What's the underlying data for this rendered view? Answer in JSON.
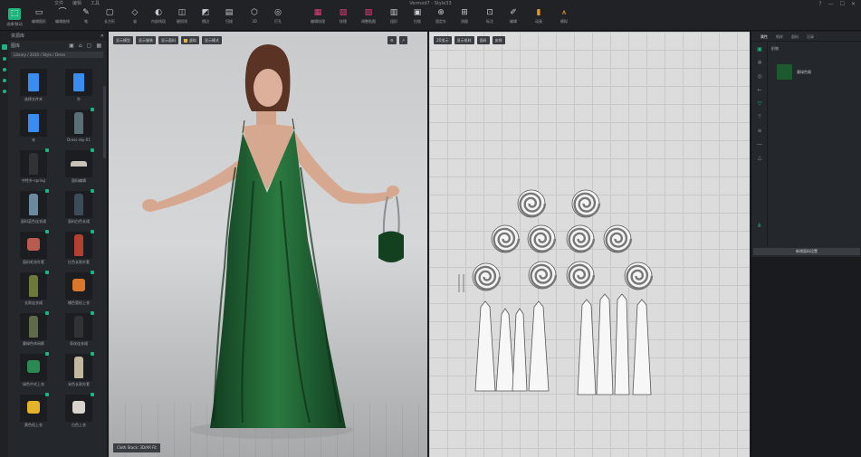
{
  "window": {
    "title": "Vermod7 - Style33",
    "menus": [
      "文件",
      "编辑",
      "工具"
    ],
    "controls": [
      "?",
      "—",
      "☐",
      "✕"
    ]
  },
  "toolbar": {
    "tools": [
      {
        "label": "选择/移动",
        "icon": "cursor-icon",
        "style": "accent"
      },
      {
        "label": "编辑图形",
        "icon": "edit-icon"
      },
      {
        "label": "编辑曲线",
        "icon": "curve-icon"
      },
      {
        "label": "笔",
        "icon": "pen-icon"
      },
      {
        "label": "长方形",
        "icon": "rectangle-icon"
      },
      {
        "label": "省",
        "icon": "dart-icon"
      },
      {
        "label": "内部线段",
        "icon": "internal-line-icon"
      },
      {
        "label": "缝纫线",
        "icon": "sewing-icon"
      },
      {
        "label": "褶边",
        "icon": "pleat-icon"
      },
      {
        "label": "归拔",
        "icon": "shrink-icon"
      },
      {
        "label": "3D",
        "icon": "cube-icon"
      },
      {
        "label": "打孔",
        "icon": "punch-icon"
      },
      {
        "label": "编辑纹理",
        "icon": "texture-edit-icon",
        "style": "pink"
      },
      {
        "label": "纹理",
        "icon": "texture-icon",
        "style": "pink"
      },
      {
        "label": "调整贴图",
        "icon": "adjust-map-icon",
        "style": "pink"
      },
      {
        "label": "纽扣",
        "icon": "button-icon"
      },
      {
        "label": "拉链",
        "icon": "zipper-icon"
      },
      {
        "label": "固定针",
        "icon": "pin-icon"
      },
      {
        "label": "测量",
        "icon": "measure-icon"
      },
      {
        "label": "标注",
        "icon": "annotate-icon"
      },
      {
        "label": "编辑",
        "icon": "edit-note-icon"
      },
      {
        "label": "动画",
        "icon": "chart-icon",
        "style": "orange"
      },
      {
        "label": "模拟",
        "icon": "hanger-icon",
        "style": "orange"
      }
    ]
  },
  "library": {
    "panel_title": "资源库",
    "tab_label": "图库",
    "path": "Library / 2020 / Style / Dress",
    "items": [
      {
        "label": "选择文件夹",
        "shape": "folder",
        "color": "#3a8df0"
      },
      {
        "label": "外",
        "shape": "folder",
        "color": "#3a8df0"
      },
      {
        "label": "夹",
        "shape": "folder",
        "color": "#3a8df0"
      },
      {
        "label": "Dress-sky-01",
        "shape": "dress",
        "color": "#5b6f76"
      },
      {
        "label": "中性外-spring",
        "shape": "dress",
        "color": "#2f3336"
      },
      {
        "label": "面料编辑",
        "shape": "hat",
        "color": "#c7c2b8"
      },
      {
        "label": "面料蓝色连衣裙",
        "shape": "dress",
        "color": "#6a8aa0"
      },
      {
        "label": "面料白色长裙",
        "shape": "dress",
        "color": "#3c4c58"
      },
      {
        "label": "面料毛衣外套",
        "shape": "top",
        "color": "#b85c50"
      },
      {
        "label": "红色长款外套",
        "shape": "dress",
        "color": "#b3412f"
      },
      {
        "label": "长款连衣裙",
        "shape": "dress",
        "color": "#6b7a3a"
      },
      {
        "label": "橘色宽松上衣",
        "shape": "top",
        "color": "#d9782c"
      },
      {
        "label": "墨绿色休闲裤",
        "shape": "dress",
        "color": "#5f6a4a"
      },
      {
        "label": "条纹连衣裙",
        "shape": "dress",
        "color": "#2f3336"
      },
      {
        "label": "绿色中式上衣",
        "shape": "top",
        "color": "#2b8a52"
      },
      {
        "label": "米色长款外套",
        "shape": "dress",
        "color": "#c2b8a0"
      },
      {
        "label": "黄色短上衣",
        "shape": "top",
        "color": "#e3b428"
      },
      {
        "label": "白色上衣",
        "shape": "top",
        "color": "#d8d4cc"
      }
    ]
  },
  "viewport3d": {
    "buttons": [
      "显示模型",
      "显示服装",
      "显示面料",
      "虚拟",
      "显示模式"
    ],
    "right_buttons": [
      "⚙",
      "↗"
    ],
    "status": "Cloth Stack: 3D/AR Fit",
    "dress_color": "#1d5a30"
  },
  "viewport2d": {
    "buttons": [
      "2D显示",
      "显示纸样",
      "面料",
      "安排"
    ]
  },
  "properties": {
    "tabs": [
      "属性",
      "纸样",
      "面料",
      "记录"
    ],
    "active_tab": "属性",
    "fabric_list_label": "织物",
    "fabric_name": "墨绿色缎",
    "fabric_color": "#1d5a30",
    "action_button": "新增面料设置"
  }
}
